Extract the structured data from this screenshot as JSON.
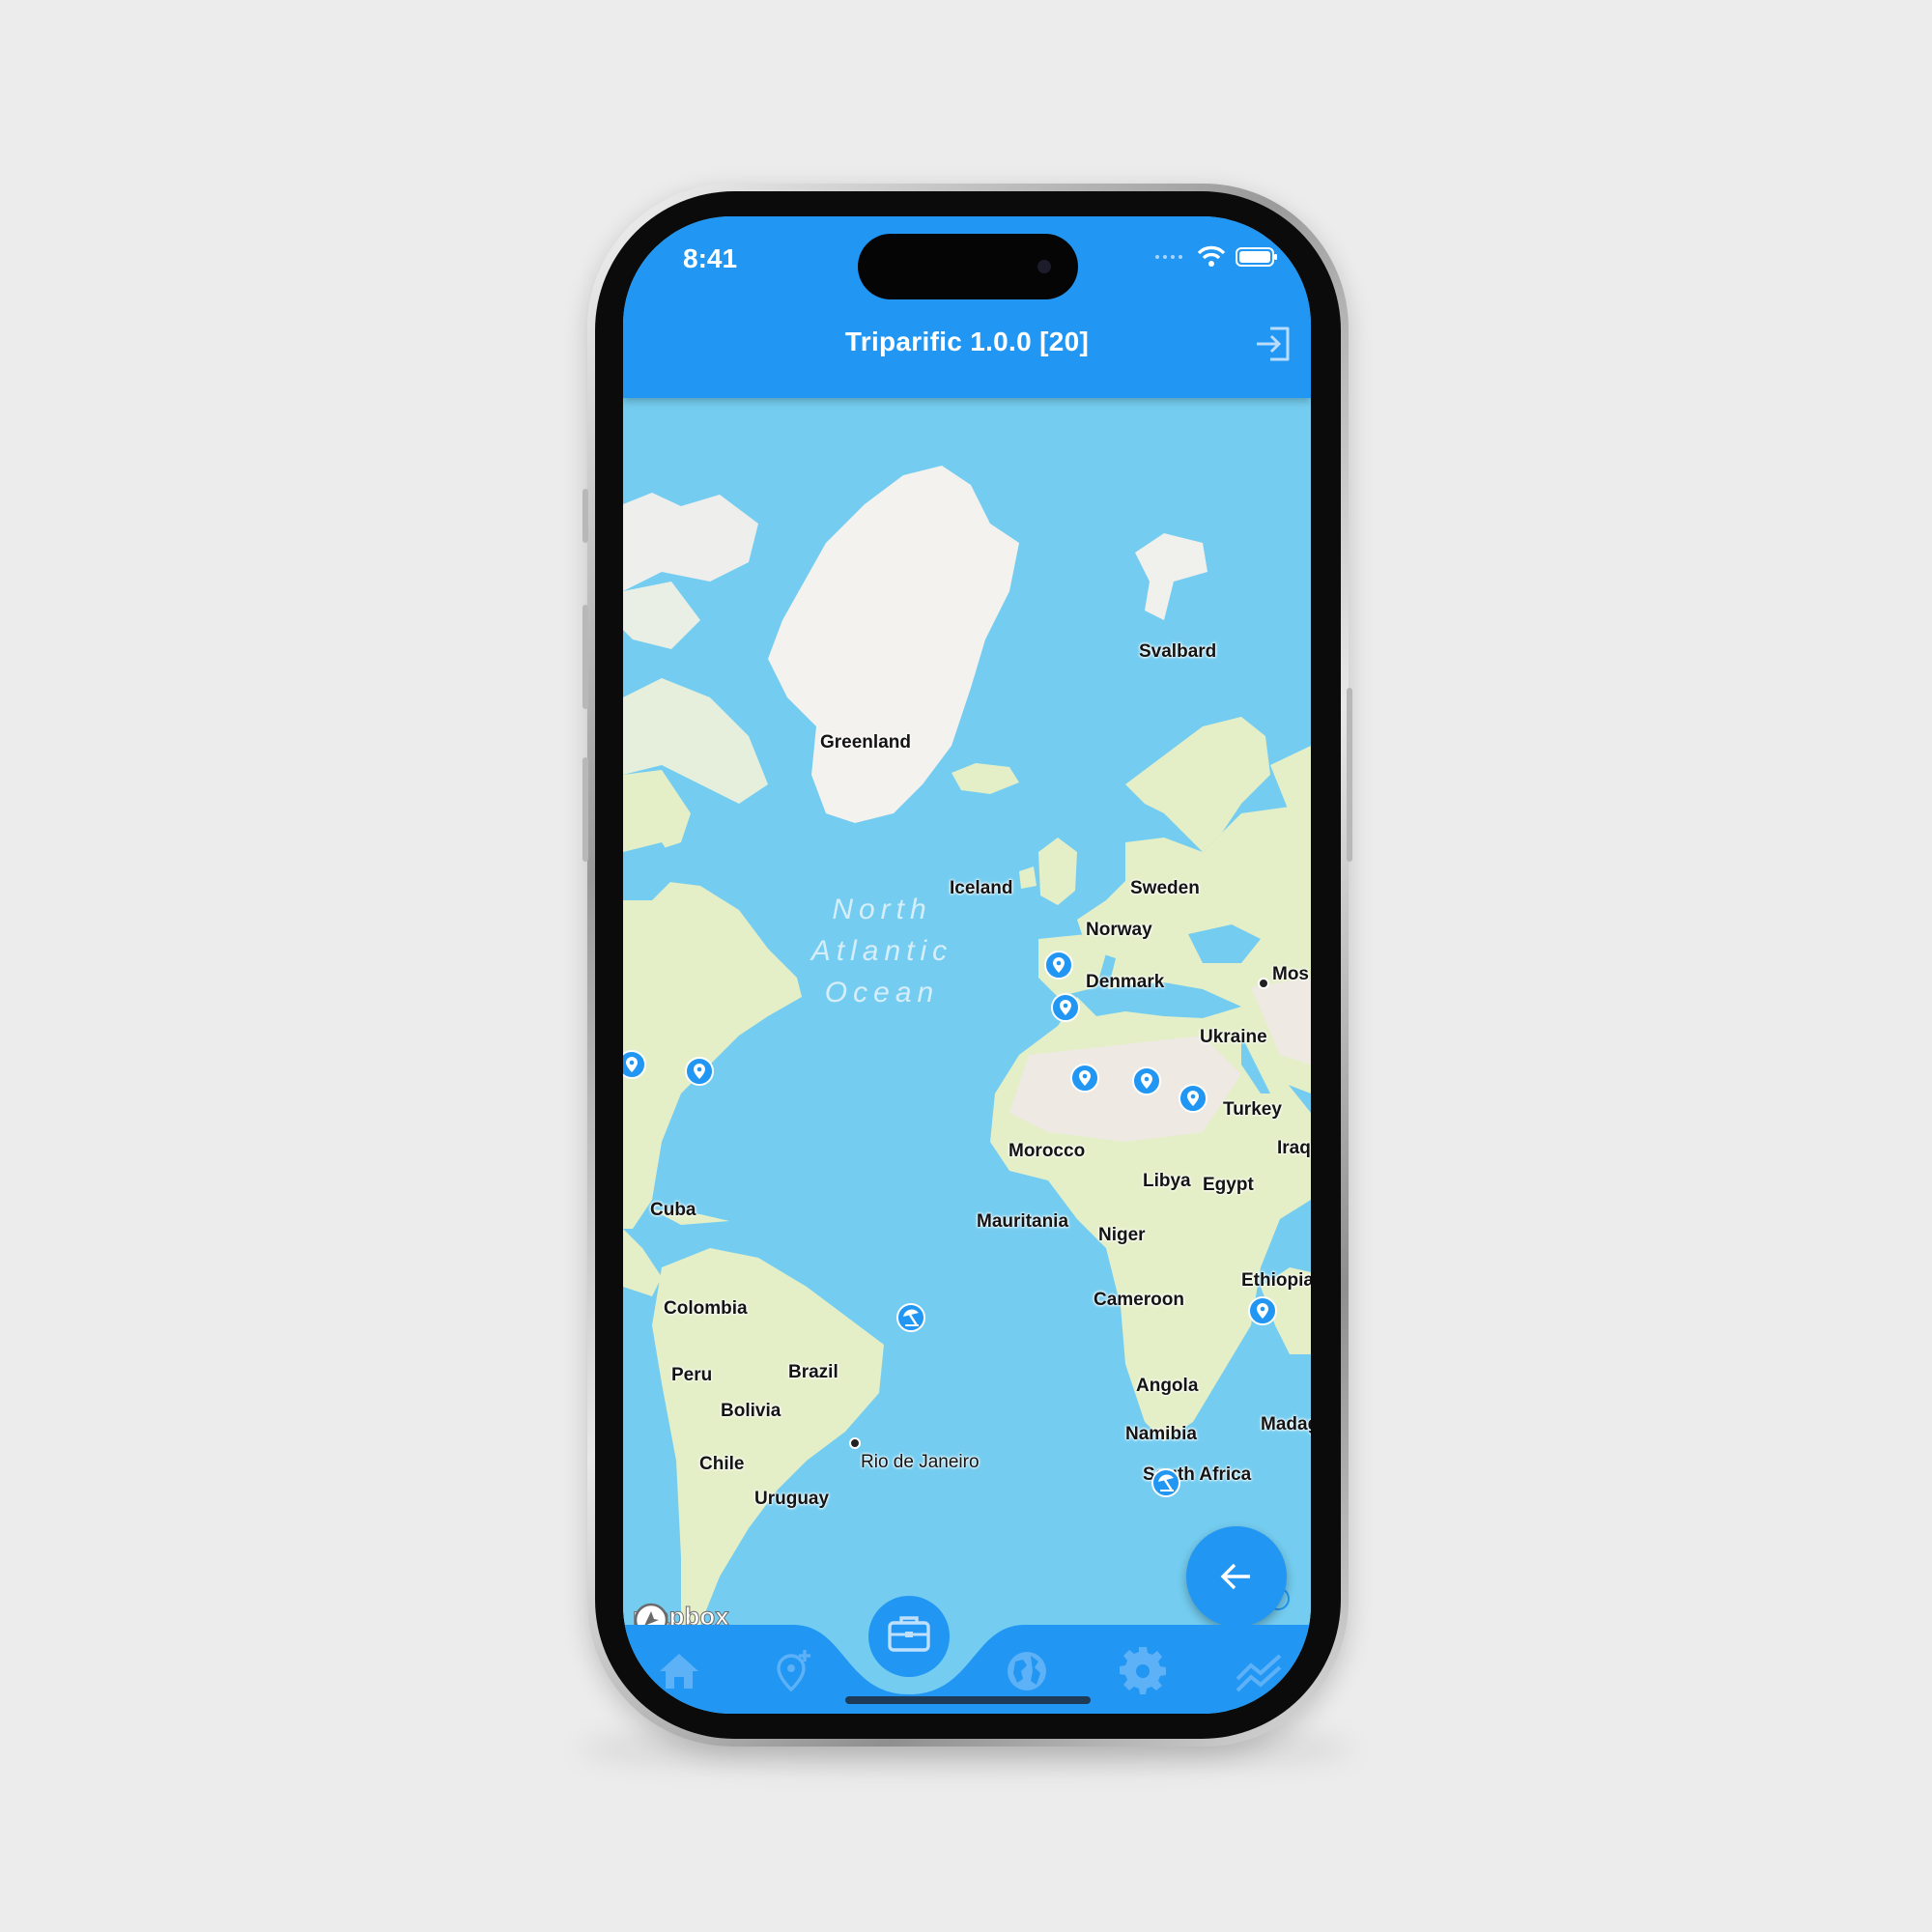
{
  "status_bar": {
    "time": "8:41"
  },
  "app_bar": {
    "title": "Triparific 1.0.0 [20]",
    "login_icon": "login-icon"
  },
  "map": {
    "ocean_label": [
      "North",
      "Atlantic",
      "Ocean"
    ],
    "place_labels": {
      "greenland": "Greenland",
      "svalbard": "Svalbard",
      "iceland": "Iceland",
      "sweden": "Sweden",
      "norway": "Norway",
      "denmark": "Denmark",
      "moscow": "Mos",
      "ukraine": "Ukraine",
      "turkey": "Turkey",
      "iraq": "Iraq",
      "morocco": "Morocco",
      "libya": "Libya",
      "egypt": "Egypt",
      "mauritania": "Mauritania",
      "niger": "Niger",
      "cuba": "Cuba",
      "ethiopia": "Ethiopia",
      "cameroon": "Cameroon",
      "colombia": "Colombia",
      "brazil": "Brazil",
      "peru": "Peru",
      "bolivia": "Bolivia",
      "angola": "Angola",
      "namibia": "Namibia",
      "madagascar": "Madag",
      "chile": "Chile",
      "rio": "Rio de Janeiro",
      "uruguay": "Uruguay",
      "south_africa": "South Africa"
    },
    "attribution": "mapbox",
    "water_color": "#74cdf0",
    "land_color": "#e8f0cf",
    "pin_color": "#2196f3"
  },
  "fab": {
    "icon": "arrow-left-icon"
  },
  "bottom_nav": {
    "items": [
      "home-icon",
      "add-location-icon",
      "briefcase-icon",
      "globe-icon",
      "settings-icon",
      "stats-icon"
    ],
    "selected": "briefcase-icon",
    "accent": "#2196f3"
  }
}
